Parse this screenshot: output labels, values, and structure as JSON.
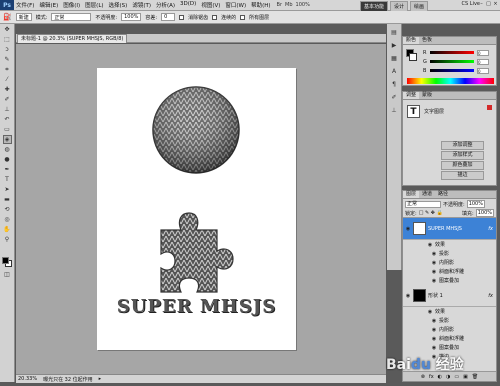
{
  "menu": {
    "logo": "Ps",
    "items": [
      "文件(F)",
      "编辑(E)",
      "图像(I)",
      "图层(L)",
      "选择(S)",
      "滤镜(T)",
      "分析(A)",
      "3D(D)",
      "视图(V)",
      "窗口(W)",
      "帮助(H)"
    ],
    "tools": [
      "Br",
      "Mb",
      "100%"
    ],
    "workspaces": [
      "基本功能",
      "设计",
      "绘画"
    ],
    "cs_live": "CS Live",
    "window_controls": [
      "–",
      "□",
      "×"
    ]
  },
  "options": {
    "preset": "新建",
    "mode_label": "模式:",
    "mode_value": "正常",
    "opacity_label": "不透明度:",
    "opacity_value": "100%",
    "tolerance_label": "容差:",
    "tolerance_value": "0",
    "antialias": "消除锯齿",
    "contiguous": "连续的",
    "all_layers": "所有图层"
  },
  "document": {
    "tab_title": "未标题-1 @ 20.3% (SUPER MHSJS, RGB/8)",
    "text": "SUPER MHSJS",
    "zoom": "20.33%",
    "status": "曝光只在 32 位起作用"
  },
  "color_panel": {
    "tabs": [
      "颜色",
      "色板"
    ],
    "channels": [
      {
        "name": "R",
        "value": "0"
      },
      {
        "name": "G",
        "value": "0"
      },
      {
        "name": "B",
        "value": "0"
      }
    ]
  },
  "adjust_panel": {
    "tabs": [
      "调整",
      "蒙版"
    ],
    "title": "文字图层",
    "buttons": [
      "添加调整",
      "添加样式",
      "颜色叠加",
      "描边"
    ]
  },
  "layers_panel": {
    "tabs": [
      "图层",
      "通道",
      "路径"
    ],
    "blend_mode": "正常",
    "opacity_label": "不透明度:",
    "opacity_value": "100%",
    "lock_label": "锁定:",
    "fill_label": "填充:",
    "fill_value": "100%",
    "layers": [
      {
        "name": "SUPER MHSJS",
        "thumb": "T",
        "selected": true,
        "effects_label": "效果",
        "effects": [
          "投影",
          "内阴影",
          "斜面和浮雕",
          "图案叠加"
        ]
      },
      {
        "name": "形状 1",
        "thumb": "",
        "selected": false,
        "effects_label": "效果",
        "effects": [
          "投影",
          "内阴影",
          "斜面和浮雕",
          "图案叠加",
          "描边"
        ]
      }
    ],
    "footer_icons": [
      "link-icon",
      "fx-icon",
      "mask-icon",
      "adjust-icon",
      "folder-icon",
      "new-layer-icon",
      "trash-icon"
    ]
  },
  "colors": {
    "app_bg": "#5a5a5a",
    "canvas_bg": "#a6a6a6",
    "selection": "#3d82d6"
  }
}
